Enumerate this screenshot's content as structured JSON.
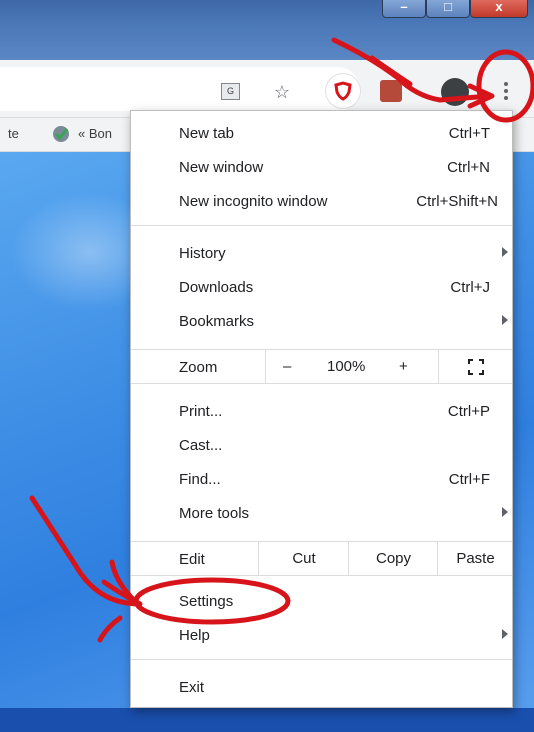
{
  "window": {
    "buttons": [
      "minimize",
      "maximize",
      "close"
    ],
    "close_glyph": "x"
  },
  "toolbar": {
    "icons": [
      "translate-icon",
      "star-icon",
      "shield-extension-icon",
      "extension-icon",
      "profile-icon",
      "more-options-icon"
    ]
  },
  "bookmarks": {
    "item1": "te",
    "item2": "« Bon"
  },
  "menu": {
    "new_tab": {
      "label": "New tab",
      "shortcut": "Ctrl+T"
    },
    "new_window": {
      "label": "New window",
      "shortcut": "Ctrl+N"
    },
    "new_incognito": {
      "label": "New incognito window",
      "shortcut": "Ctrl+Shift+N"
    },
    "history": {
      "label": "History"
    },
    "downloads": {
      "label": "Downloads",
      "shortcut": "Ctrl+J"
    },
    "bookmarks": {
      "label": "Bookmarks"
    },
    "zoom": {
      "label": "Zoom",
      "minus": "–",
      "value": "100%",
      "plus": "+"
    },
    "print": {
      "label": "Print...",
      "shortcut": "Ctrl+P"
    },
    "cast": {
      "label": "Cast..."
    },
    "find": {
      "label": "Find...",
      "shortcut": "Ctrl+F"
    },
    "more_tools": {
      "label": "More tools"
    },
    "edit": {
      "label": "Edit",
      "cut": "Cut",
      "copy": "Copy",
      "paste": "Paste"
    },
    "settings": {
      "label": "Settings"
    },
    "help": {
      "label": "Help"
    },
    "exit": {
      "label": "Exit"
    }
  },
  "colors": {
    "annotation": "#d8141b",
    "page_blue": "#3f8fe6",
    "titlebar": "#4b78b8"
  }
}
